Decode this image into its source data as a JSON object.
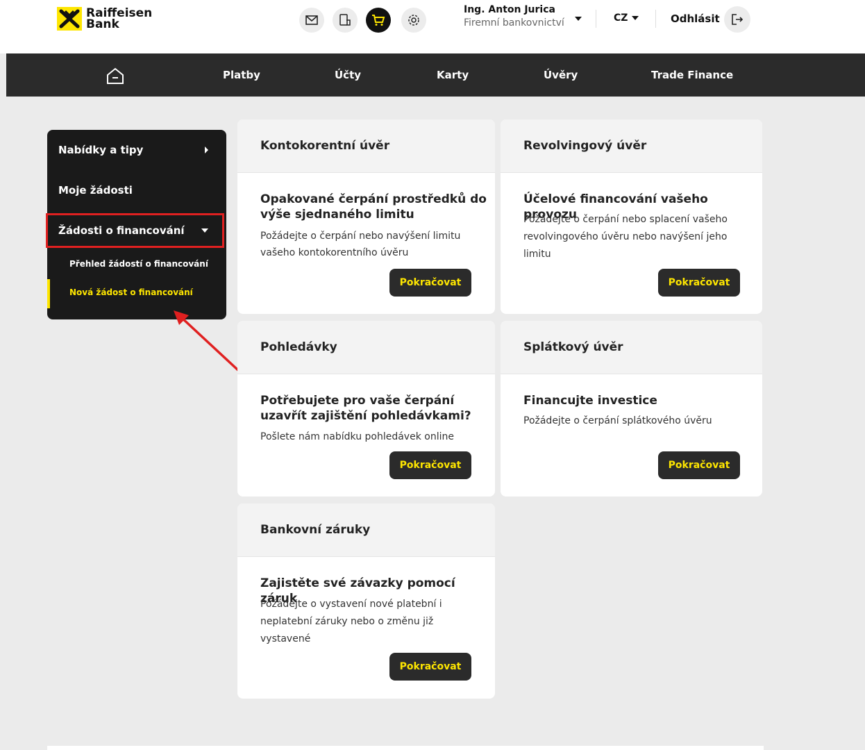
{
  "brand": {
    "name_line1": "Raiffeisen",
    "name_line2": "Bank",
    "accent": "#fee600"
  },
  "header": {
    "icons": [
      "mail-icon",
      "mobile-icon",
      "cart-icon",
      "settings-icon"
    ],
    "user_name": "Ing. Anton Jurica",
    "user_role": "Firemní bankovnictví",
    "language": "CZ",
    "logout_label": "Odhlásit"
  },
  "nav": {
    "items": [
      "Platby",
      "Účty",
      "Karty",
      "Úvěry",
      "Trade Finance"
    ]
  },
  "sidebar": {
    "items": [
      {
        "label": "Nabídky a tipy"
      },
      {
        "label": "Moje žádosti"
      },
      {
        "label": "Žádosti o financování"
      }
    ],
    "subitems": [
      {
        "label": "Přehled žádostí o financování"
      },
      {
        "label": "Nová žádost o financování"
      }
    ]
  },
  "cards": [
    {
      "header": "Kontokorentní úvěr",
      "title_lines": [
        "Opakované čerpání prostředků do",
        "výše sjednaného limitu"
      ],
      "desc_lines": [
        "Požádejte o čerpání nebo navýšení limitu",
        "vašeho kontokorentního úvěru"
      ],
      "button": "Pokračovat"
    },
    {
      "header": "Revolvingový úvěr",
      "title_lines": [
        "Účelové financování vašeho provozu"
      ],
      "desc_lines": [
        "Požádejte o čerpání nebo splacení vašeho",
        "revolvingového úvěru nebo navýšení jeho",
        "limitu"
      ],
      "button": "Pokračovat"
    },
    {
      "header": "Pohledávky",
      "title_lines": [
        "Potřebujete pro vaše čerpání",
        "uzavřít zajištění pohledávkami?"
      ],
      "desc_lines": [
        "Pošlete nám nabídku pohledávek online"
      ],
      "button": "Pokračovat"
    },
    {
      "header": "Splátkový úvěr",
      "title_lines": [
        "Financujte investice"
      ],
      "desc_lines": [
        "Požádejte o čerpání splátkového úvěru"
      ],
      "button": "Pokračovat"
    },
    {
      "header": "Bankovní záruky",
      "title_lines": [
        "Zajistěte své závazky pomocí záruk"
      ],
      "desc_lines": [
        "Požádejte o vystavení nové platební i",
        "neplatební záruky nebo o změnu již",
        "vystavené"
      ],
      "button": "Pokračovat"
    }
  ]
}
